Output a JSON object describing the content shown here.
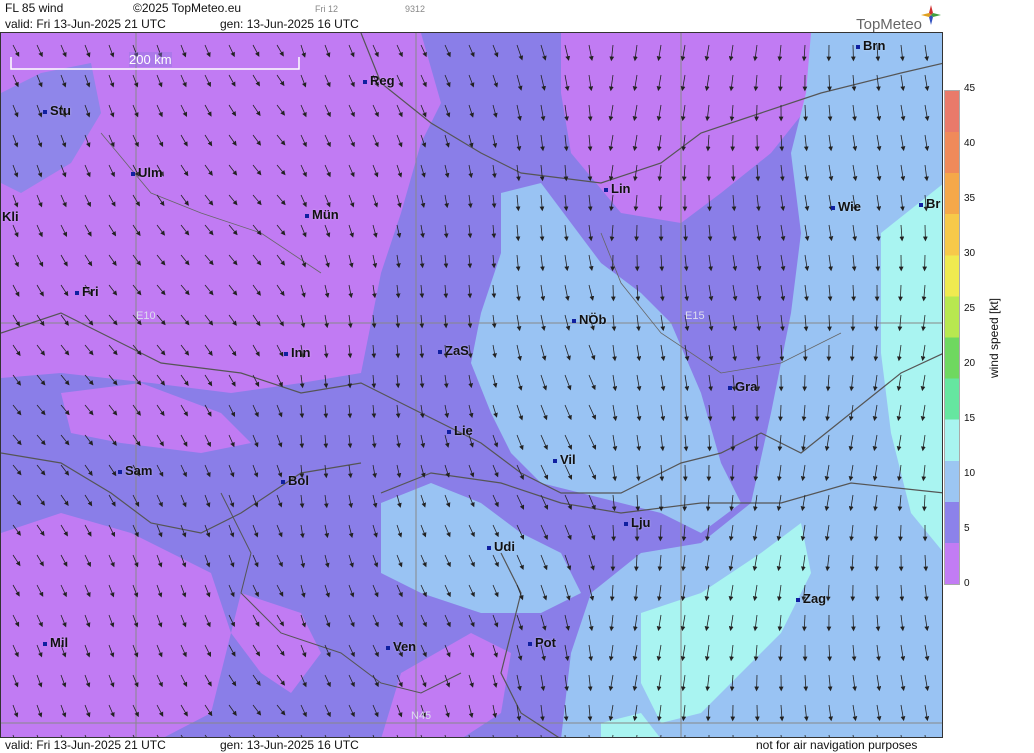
{
  "header": {
    "title": "FL 85 wind",
    "copyright": "©2025 TopMeteo.eu",
    "day_code": "Fri 12",
    "code": "9312",
    "valid": "valid:  Fri  13-Jun-2025  21 UTC",
    "generated": "gen: 13-Jun-2025 16 UTC",
    "logo_text": "TopMeteo"
  },
  "footer": {
    "valid": "valid:  Fri  13-Jun-2025  21 UTC",
    "generated": "gen: 13-Jun-2025 16 UTC",
    "disclaimer": "not for air navigation purposes"
  },
  "map": {
    "scale_label": "200 km",
    "grid_labels": [
      "E10",
      "E15",
      "N45"
    ],
    "cities": [
      {
        "name": "Reg"
      },
      {
        "name": "Brn"
      },
      {
        "name": "Stu"
      },
      {
        "name": "Ulm"
      },
      {
        "name": "Mün"
      },
      {
        "name": "Lin"
      },
      {
        "name": "Wie"
      },
      {
        "name": "Br"
      },
      {
        "name": "Kli"
      },
      {
        "name": "Fri"
      },
      {
        "name": "NÖb"
      },
      {
        "name": "Inn"
      },
      {
        "name": "ZaS"
      },
      {
        "name": "Gra"
      },
      {
        "name": "Lie"
      },
      {
        "name": "Vil"
      },
      {
        "name": "Sam"
      },
      {
        "name": "Bol"
      },
      {
        "name": "Lju"
      },
      {
        "name": "Udi"
      },
      {
        "name": "Zag"
      },
      {
        "name": "Mil"
      },
      {
        "name": "Ven"
      },
      {
        "name": "Pot"
      }
    ]
  },
  "legend": {
    "title": "wind  speed  [kt]",
    "ticks": [
      "45",
      "40",
      "35",
      "30",
      "25",
      "20",
      "15",
      "10",
      "5",
      "0"
    ],
    "colors": [
      "#e97a6a",
      "#f08a5a",
      "#f5a84a",
      "#f7c94a",
      "#f0ea50",
      "#b8e850",
      "#6fd860",
      "#66e6a0",
      "#a8f4f0",
      "#9cc6f2",
      "#8c82ea",
      "#c27cf4"
    ]
  }
}
